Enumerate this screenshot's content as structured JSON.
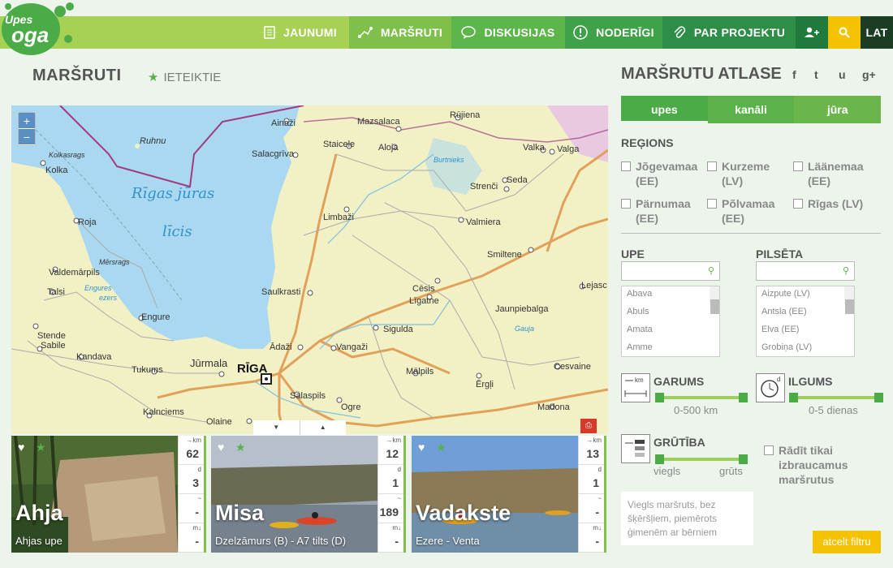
{
  "brand": {
    "top": "Upes",
    "bottom": "oga"
  },
  "nav": [
    {
      "label": "JAUNUMI",
      "icon": "document-icon"
    },
    {
      "label": "MARŠRUTI",
      "icon": "route-icon"
    },
    {
      "label": "DISKUSIJAS",
      "icon": "chat-icon"
    },
    {
      "label": "NODERĪGI",
      "icon": "exclamation-icon"
    },
    {
      "label": "PAR PROJEKTU",
      "icon": "paperclip-icon"
    }
  ],
  "lang": "LAT",
  "page": {
    "title": "MARŠRUTI",
    "recommended": "IETEIKTIE"
  },
  "map": {
    "zoom_in": "+",
    "zoom_out": "−",
    "sea_label_1": "Rīgas jūras",
    "sea_label_2": "līcis",
    "labels": {
      "ainazi": "Ainaži",
      "mazsalaca": "Mazsalaca",
      "rujiena": "Rūjiena",
      "ruhnu": "Ruhnu",
      "staicele": "Staicele",
      "aloja": "Aloja",
      "valka": "Valka",
      "valga": "Valga",
      "salacgriva": "Salacgrīva",
      "burtnieks": "Burtnieks",
      "kolkasrags": "Kolkasrags",
      "kolka": "Kolka",
      "strenci": "Strenči",
      "seda": "Seda",
      "limbazi": "Limbaži",
      "valmiera": "Valmiera",
      "roja": "Roja",
      "smiltene": "Smiltene",
      "valdemarpils": "Valdemārpils",
      "mersrags": "Mērsrags",
      "talsi": "Talsi",
      "engures": "Engures",
      "ezers": "ezers",
      "saulkrasti": "Saulkrasti",
      "cesis": "Cēsis",
      "ligatne": "Līgatne",
      "lejasc": "Lejasc",
      "jaunpiebalga": "Jaunpiebalga",
      "engure": "Engure",
      "stende": "Stende",
      "sigulda": "Sigulda",
      "gauja": "Gauja",
      "sabile": "Sabile",
      "kandava": "Kandava",
      "adazi": "Ādaži",
      "vangazi": "Vangaži",
      "jurmala": "Jūrmala",
      "riga": "RĪGA",
      "tukums": "Tukums",
      "cesvaine": "Cesvaine",
      "malpils": "Mālpils",
      "ergli": "Ērgļi",
      "salaspils": "Salaspils",
      "ogre": "Ogre",
      "madona": "Madona",
      "kalnciems": "Kalnciems",
      "olaine": "Olaine"
    },
    "ctrl_down": "▼",
    "ctrl_up": "▲"
  },
  "cards": [
    {
      "title": "Ahja",
      "subtitle": "Ahjas upe",
      "stats": [
        {
          "unit": "→km",
          "value": "62"
        },
        {
          "unit": "d",
          "value": "3"
        },
        {
          "unit": "~",
          "value": "-"
        },
        {
          "unit": "m↓",
          "value": "-"
        }
      ]
    },
    {
      "title": "Misa",
      "subtitle": "Dzelzāmurs (B) - A7 tilts (D)",
      "stats": [
        {
          "unit": "→km",
          "value": "12"
        },
        {
          "unit": "d",
          "value": "1"
        },
        {
          "unit": "~",
          "value": "189"
        },
        {
          "unit": "m↓",
          "value": "-"
        }
      ]
    },
    {
      "title": "Vadakste",
      "subtitle": "Ezere - Venta",
      "stats": [
        {
          "unit": "→km",
          "value": "13"
        },
        {
          "unit": "d",
          "value": "1"
        },
        {
          "unit": "~",
          "value": "-"
        },
        {
          "unit": "m↓",
          "value": "-"
        }
      ]
    }
  ],
  "atlas": {
    "title": "MARŠRUTU ATLASE",
    "social": [
      "f",
      "t",
      "u",
      "g+"
    ],
    "tabs": [
      "upes",
      "kanāli",
      "jūra"
    ],
    "regions_title": "REĢIONS",
    "regions": [
      "Jõgevamaa (EE)",
      "Kurzeme (LV)",
      "Läänemaa (EE)",
      "Pärnumaa (EE)",
      "Põlvamaa (EE)",
      "Rīgas (LV)"
    ],
    "river_title": "UPE",
    "city_title": "PILSĒTA",
    "rivers": [
      "Abava",
      "Abuls",
      "Amata",
      "Amme"
    ],
    "cities": [
      "Aizpute (LV)",
      "Antsla (EE)",
      "Elva (EE)",
      "Grobiņa (LV)"
    ],
    "length_title": "GARUMS",
    "length_range": "0-500 km",
    "duration_title": "ILGUMS",
    "duration_range": "0-5 dienas",
    "difficulty_title": "GRŪTĪBA",
    "easy": "viegls",
    "hard": "grūts",
    "only_drivable": "Rādīt tikai izbraucamus maršrutus",
    "difficulty_desc": "Viegls maršruts, bez šķēršļiem, piemērots ģimenēm ar bērniem",
    "reset": "atcelt filtru"
  },
  "colors": {
    "green": "#4aab47",
    "lightgreen": "#8fc741",
    "yellow": "#f4c200",
    "sea": "#a9d8f0",
    "land": "#f2f1c6"
  }
}
